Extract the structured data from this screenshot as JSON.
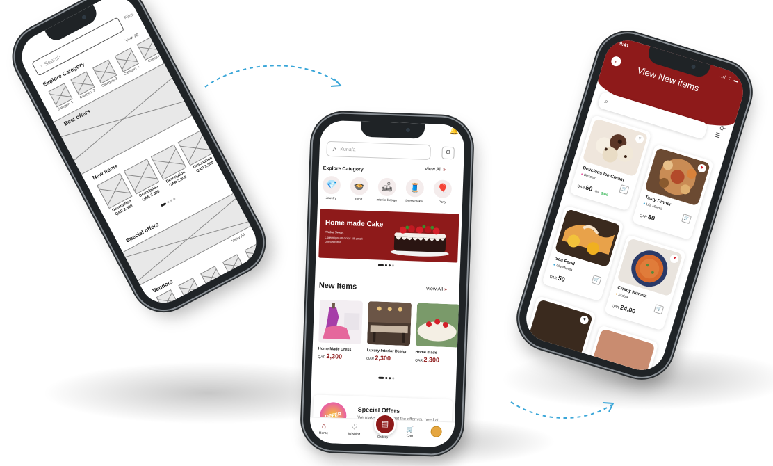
{
  "wireframe": {
    "status_time": "9:41",
    "search_placeholder": "Search",
    "filter_label": "Filter",
    "explore_title": "Explore Category",
    "view_all": "View All",
    "categories": [
      "Category 1",
      "Category 2",
      "Category 3",
      "Category 4",
      "Categor"
    ],
    "best_offers_title": "Best offers",
    "new_items_title": "New items",
    "new_items": [
      {
        "desc": "Description",
        "price": "QAR 2,300"
      },
      {
        "desc": "Description",
        "price": "QAR 2,300"
      },
      {
        "desc": "Description",
        "price": "QAR 2,300"
      },
      {
        "desc": "Description",
        "price": "QAR 2,300"
      }
    ],
    "special_offers_title": "Special offers",
    "view_all_2": "View All",
    "vendors_title": "Vendors"
  },
  "home": {
    "search_placeholder": "Kunafa",
    "explore_title": "Explore Category",
    "view_all": "View All",
    "chevrons": "»",
    "categories": [
      {
        "label": "Jewelry",
        "icon": "gem-icon",
        "glyph": "💎"
      },
      {
        "label": "Food",
        "icon": "food-cover-icon",
        "glyph": "🍲"
      },
      {
        "label": "Interior Design",
        "icon": "sofa-icon",
        "glyph": "🛋"
      },
      {
        "label": "Dress maker",
        "icon": "sewing-machine-icon",
        "glyph": "🧵"
      },
      {
        "label": "Party",
        "icon": "balloon-icon",
        "glyph": "🎈"
      }
    ],
    "banner": {
      "title": "Home made Cake",
      "seller": "Arabia Sweet",
      "desc": "Lorem ipsum dolor sit amet consectetur."
    },
    "new_items_title": "New Items",
    "new_items_view_all": "View All",
    "new_items": [
      {
        "name": "Home Made Dress",
        "currency": "QAR",
        "price": "2,300"
      },
      {
        "name": "Luxury Interior Design",
        "currency": "QAR",
        "price": "2,300"
      },
      {
        "name": "Home made",
        "currency": "QAR",
        "price": "2,300"
      }
    ],
    "special": {
      "title": "Special Offers",
      "desc": "We make sure you get the offer you need at best prices.",
      "badge": "OFFER"
    },
    "tabs": [
      {
        "label": "Home",
        "icon": "home-icon",
        "glyph": "⌂"
      },
      {
        "label": "Wishlist",
        "icon": "heart-icon",
        "glyph": "♡"
      },
      {
        "label": "Orders",
        "icon": "orders-icon",
        "glyph": "▤"
      },
      {
        "label": "Cart",
        "icon": "cart-icon",
        "glyph": "🛒"
      }
    ]
  },
  "new_items_screen": {
    "status_time": "9:41",
    "status_icons": "..ıl ⌔ ▬",
    "title": "View New items",
    "search_glyph": "⌕",
    "items": [
      {
        "name": "Delicious Ice Cream",
        "vendor": "Dessert",
        "currency": "QAR",
        "price": "50",
        "old_price": "70",
        "discount": "30%"
      },
      {
        "name": "Tasty Dinner",
        "vendor": "Lila Mumla",
        "currency": "QAR",
        "price": "80"
      },
      {
        "name": "Sea Food",
        "vendor": "Lila Mumla",
        "currency": "QAR",
        "price": "50"
      },
      {
        "name": "Crispy Kunafa",
        "vendor": "Arabia",
        "currency": "QAR",
        "price": "24.00"
      }
    ]
  },
  "colors": {
    "brand": "#8e1a1a",
    "discount": "#2bb24c",
    "arrow": "#3aa6d8"
  }
}
